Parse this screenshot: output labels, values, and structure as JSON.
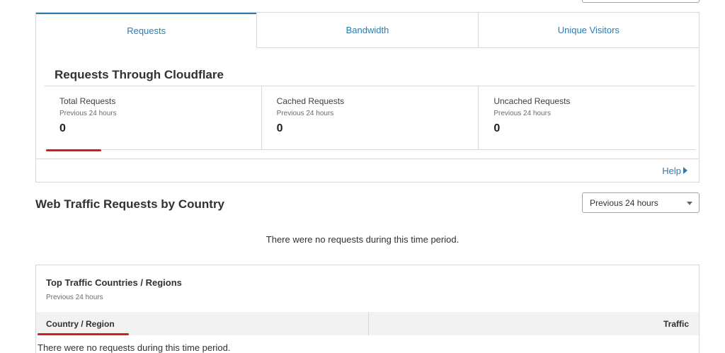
{
  "tabs": [
    {
      "label": "Requests",
      "active": true
    },
    {
      "label": "Bandwidth",
      "active": false
    },
    {
      "label": "Unique Visitors",
      "active": false
    }
  ],
  "card": {
    "title": "Requests Through Cloudflare",
    "stats": [
      {
        "label": "Total Requests",
        "sub": "Previous 24 hours",
        "value": "0"
      },
      {
        "label": "Cached Requests",
        "sub": "Previous 24 hours",
        "value": "0"
      },
      {
        "label": "Uncached Requests",
        "sub": "Previous 24 hours",
        "value": "0"
      }
    ],
    "help_label": "Help"
  },
  "country_section": {
    "title": "Web Traffic Requests by Country",
    "period_select": "Previous 24 hours",
    "empty_message": "There were no requests during this time period."
  },
  "top_countries": {
    "title": "Top Traffic Countries / Regions",
    "sub": "Previous 24 hours",
    "columns": [
      "Country / Region",
      "Traffic"
    ],
    "empty_message": "There were no requests during this time period."
  },
  "colors": {
    "accent": "#2c7cb0",
    "annotation": "#d01d1d"
  },
  "icons": [
    "triangle-right-icon",
    "chevron-down-icon"
  ]
}
